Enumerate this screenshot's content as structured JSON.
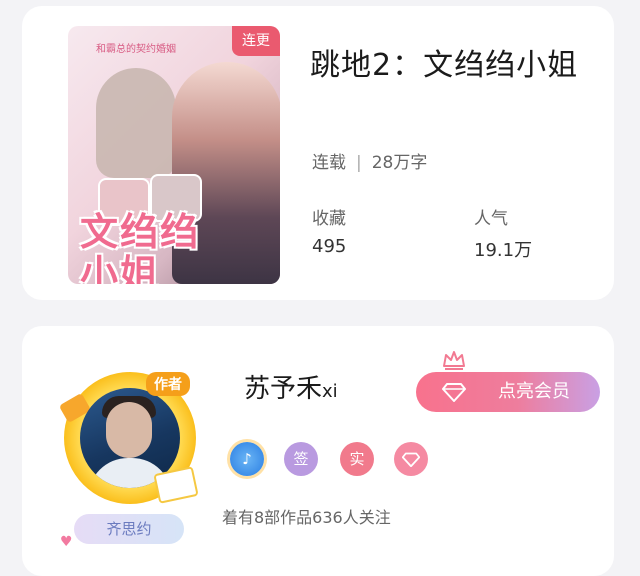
{
  "book": {
    "status_tag": "连更",
    "cover_small_text": "和霸总的契约婚姻",
    "cover_title": "文绉绉小姐",
    "title": "跳地2：文绉绉小姐",
    "status": "连载",
    "word_count": "28万字",
    "favorites_label": "收藏",
    "favorites_value": "495",
    "popularity_label": "人气",
    "popularity_value": "19.1万"
  },
  "author": {
    "badge": "作者",
    "name": "苏予禾",
    "name_suffix": "xi",
    "pen_tag": "齐思约",
    "vip_button": "点亮会员",
    "badges": {
      "music_icon": "music-note-icon",
      "sign": "签",
      "real": "实",
      "gem_icon": "diamond-icon"
    },
    "stats": "着有8部作品636人关注"
  },
  "colors": {
    "tag_red": "#ea5a6f",
    "vip_gradient_start": "#f8728d",
    "vip_gradient_end": "#c9a0e4",
    "sign_badge": "#b99ae0",
    "real_badge": "#f17a8c",
    "gem_badge": "#f58aa2",
    "music_badge": "#3d8ee8"
  }
}
